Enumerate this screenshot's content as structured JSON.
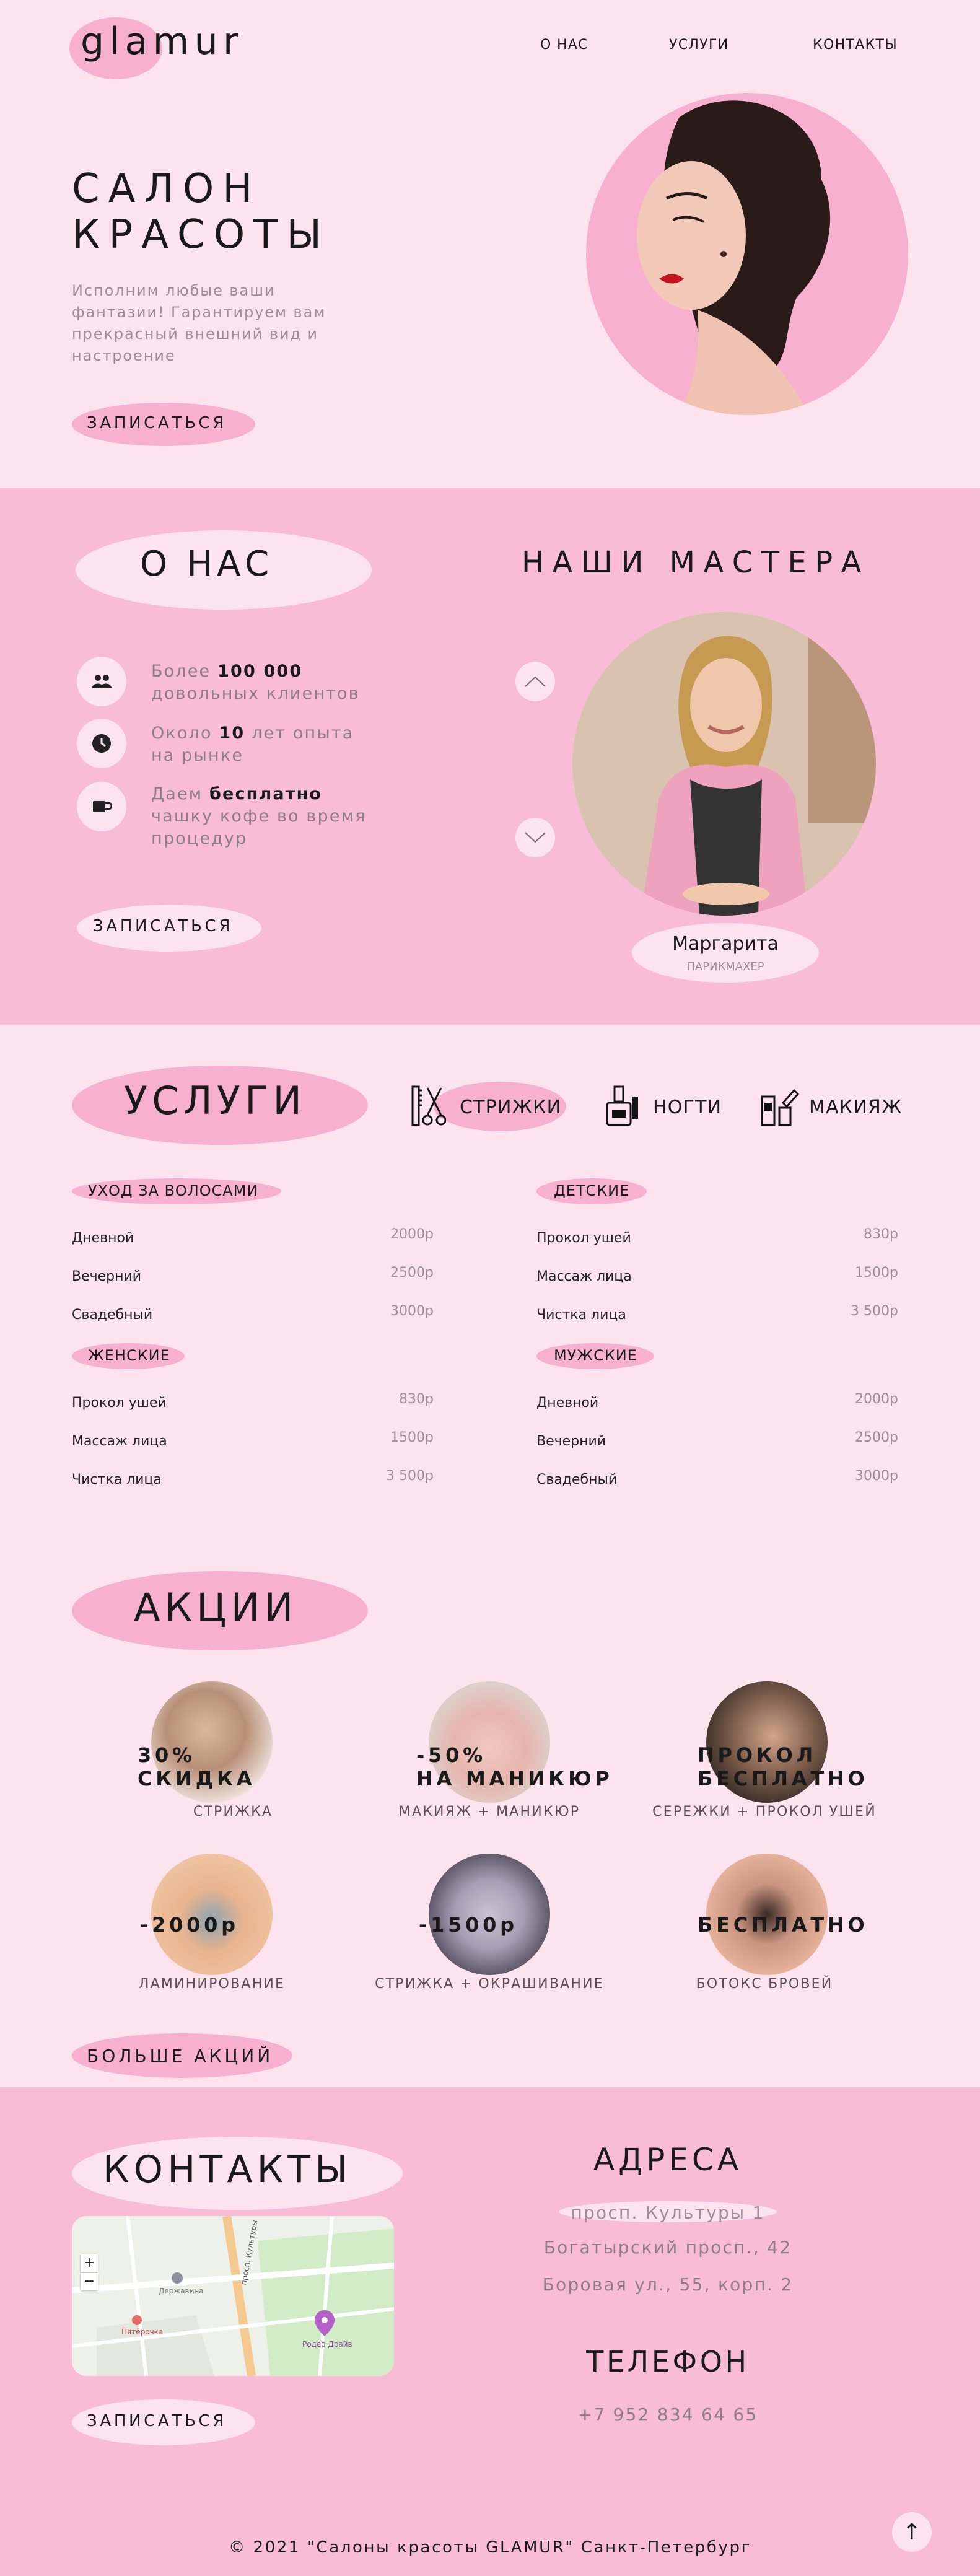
{
  "header": {
    "logo": "glamur",
    "nav": [
      "О НАС",
      "УСЛУГИ",
      "КОНТАКТЫ"
    ]
  },
  "hero": {
    "title_line1": "САЛОН",
    "title_line2": "КРАСОТЫ",
    "subtitle": "Исполним любые ваши фантазии! Гарантируем вам прекрасный внешний вид и настроение",
    "cta": "ЗАПИСАТЬСЯ"
  },
  "about": {
    "title": "О НАС",
    "features": [
      {
        "icon": "people-icon",
        "pre": "Более ",
        "bold": "100 000",
        "post": " довольных клиентов"
      },
      {
        "icon": "clock-icon",
        "pre": "Около ",
        "bold": "10",
        "post": " лет опыта на рынке"
      },
      {
        "icon": "coffee-icon",
        "pre": "Даем ",
        "bold": "бесплатно",
        "post": " чашку кофе во время процедур"
      }
    ],
    "cta": "ЗАПИСАТЬСЯ",
    "masters_title": "НАШИ МАСТЕРА",
    "master_name": "Маргарита",
    "master_role": "ПАРИКМАХЕР"
  },
  "services": {
    "title": "УСЛУГИ",
    "tabs": [
      {
        "icon": "scissors-comb-icon",
        "label": "СТРИЖКИ"
      },
      {
        "icon": "nail-polish-icon",
        "label": "НОГТИ"
      },
      {
        "icon": "makeup-icon",
        "label": "МАКИЯЖ"
      }
    ],
    "groups": [
      {
        "title": "УХОД ЗА ВОЛОСАМИ",
        "items": [
          {
            "name": "Дневной",
            "price": "2000р"
          },
          {
            "name": "Вечерний",
            "price": "2500р"
          },
          {
            "name": "Свадебный",
            "price": "3000р"
          }
        ]
      },
      {
        "title": "ДЕТСКИЕ",
        "items": [
          {
            "name": "Прокол ушей",
            "price": "830р"
          },
          {
            "name": "Массаж лица",
            "price": "1500р"
          },
          {
            "name": "Чистка лица",
            "price": "3 500р"
          }
        ]
      },
      {
        "title": "ЖЕНСКИЕ",
        "items": [
          {
            "name": "Прокол ушей",
            "price": "830р"
          },
          {
            "name": "Массаж лица",
            "price": "1500р"
          },
          {
            "name": "Чистка лица",
            "price": "3 500р"
          }
        ]
      },
      {
        "title": "МУЖСКИЕ",
        "items": [
          {
            "name": "Дневной",
            "price": "2000р"
          },
          {
            "name": "Вечерний",
            "price": "2500р"
          },
          {
            "name": "Свадебный",
            "price": "3000р"
          }
        ]
      }
    ]
  },
  "promos": {
    "title": "АКЦИИ",
    "items": [
      {
        "line1": "30%",
        "line2": "СКИДКА",
        "caption": "СТРИЖКА"
      },
      {
        "line1": "-50%",
        "line2": "НА МАНИКЮР",
        "caption": "МАКИЯЖ + МАНИКЮР"
      },
      {
        "line1": "ПРОКОЛ",
        "line2": "БЕСПЛАТНО",
        "caption": "СЕРЕЖКИ + ПРОКОЛ УШЕЙ"
      },
      {
        "line1": "-2000р",
        "line2": "",
        "caption": "ЛАМИНИРОВАНИЕ"
      },
      {
        "line1": "-1500р",
        "line2": "",
        "caption": "СТРИЖКА + ОКРАШИВАНИЕ"
      },
      {
        "line1": "БЕСПЛАТНО",
        "line2": "",
        "caption": "БОТОКС БРОВЕЙ"
      }
    ],
    "more": "БОЛЬШЕ АКЦИЙ"
  },
  "contacts": {
    "title": "КОНТАКТЫ",
    "cta": "ЗАПИСАТЬСЯ",
    "address_title": "АДРЕСА",
    "addresses": [
      "просп. Культуры 1",
      "Богатырский просп., 42",
      "Боровая ул., 55, корп. 2"
    ],
    "phone_title": "ТЕЛЕФОН",
    "phone": "+7 952 834 64 65",
    "map": {
      "zoom_in": "+",
      "zoom_out": "−",
      "place1": "Державина",
      "place2": "Пятёрочка",
      "place3": "Родео Драйв",
      "street": "просп. Культуры"
    }
  },
  "footer": {
    "copyright": "© 2021 \"Салоны красоты GLAMUR\" Санкт-Петербург",
    "to_top": "↑"
  }
}
